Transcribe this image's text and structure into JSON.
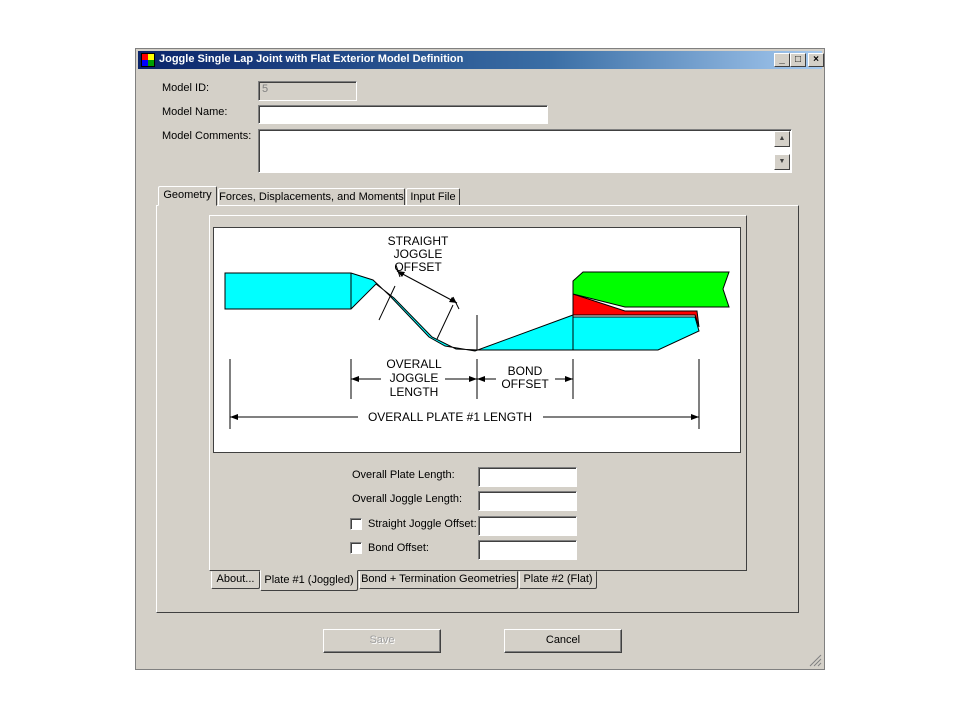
{
  "window": {
    "title": "Joggle Single Lap Joint with Flat Exterior Model Definition"
  },
  "titlebar": {
    "minimize": "_",
    "maximize": "□",
    "close": "×"
  },
  "model": {
    "id_label": "Model ID:",
    "id_value": "5",
    "name_label": "Model Name:",
    "name_value": "",
    "comments_label": "Model Comments:",
    "comments_value": ""
  },
  "top_tabs": [
    {
      "label": "Geometry"
    },
    {
      "label": "Forces, Displacements, and Moments"
    },
    {
      "label": "Input File"
    }
  ],
  "diagram": {
    "straight_joggle_offset": [
      "STRAIGHT",
      "JOGGLE",
      "OFFSET"
    ],
    "overall_joggle_length": [
      "OVERALL",
      "JOGGLE",
      "LENGTH"
    ],
    "bond_offset": [
      "BOND",
      "OFFSET"
    ],
    "overall_plate_length": "OVERALL PLATE #1 LENGTH",
    "colors": {
      "plate1": "#00ffff",
      "plate2": "#00ff00",
      "bond": "#ff0000"
    }
  },
  "fields": {
    "overall_plate_length_label": "Overall Plate Length:",
    "overall_plate_length_value": "",
    "overall_joggle_length_label": "Overall Joggle Length:",
    "overall_joggle_length_value": "",
    "straight_joggle_offset_label": "Straight Joggle Offset:",
    "straight_joggle_offset_value": "",
    "bond_offset_label": "Bond Offset:",
    "bond_offset_value": ""
  },
  "bottom_tabs": [
    {
      "label": "About..."
    },
    {
      "label": "Plate #1 (Joggled)"
    },
    {
      "label": "Bond + Termination Geometries"
    },
    {
      "label": "Plate #2 (Flat)"
    }
  ],
  "buttons": {
    "save": "Save",
    "cancel": "Cancel"
  }
}
